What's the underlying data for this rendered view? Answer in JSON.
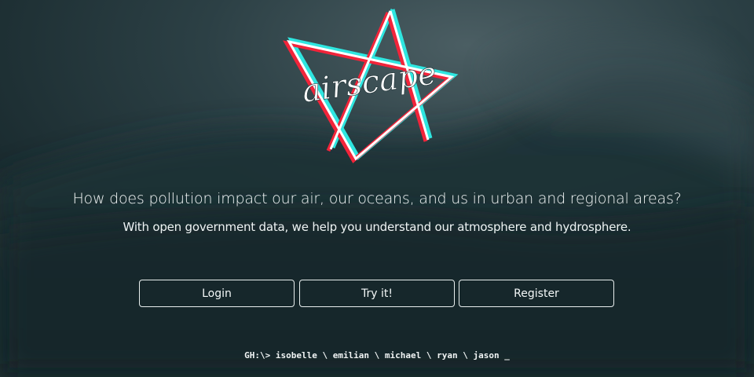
{
  "logo": {
    "wordmark": "airscape",
    "icon": "triangle-logo-icon",
    "colors": {
      "cyan": "#2fe6e0",
      "red": "#f2243a",
      "white": "#ffffff"
    }
  },
  "hero": {
    "headline": "How does pollution impact our air, our oceans, and us in urban and regional areas?",
    "subheadline": "With open government data, we help you understand our atmosphere and hydrosphere."
  },
  "actions": {
    "login_label": "Login",
    "try_label": "Try it!",
    "register_label": "Register"
  },
  "footer": {
    "github_line": "GH:\\> isobelle \\ emilian \\ michael \\ ryan \\ jason _"
  },
  "theme": {
    "background": "#1d3034"
  }
}
